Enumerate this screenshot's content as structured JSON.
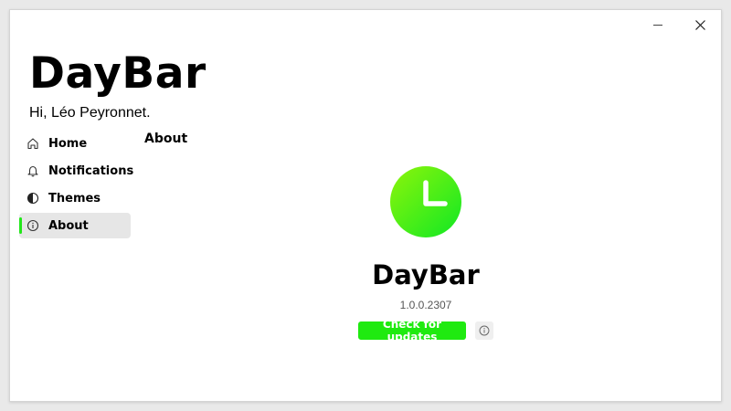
{
  "window": {
    "minimize_icon": "minimize-icon",
    "close_icon": "close-icon"
  },
  "app": {
    "title": "DayBar",
    "greeting": "Hi, Léo Peyronnet."
  },
  "nav": {
    "items": [
      {
        "label": "Home",
        "icon": "home-icon",
        "active": false
      },
      {
        "label": "Notifications",
        "icon": "bell-icon",
        "active": false
      },
      {
        "label": "Themes",
        "icon": "contrast-icon",
        "active": false
      },
      {
        "label": "About",
        "icon": "info-icon",
        "active": true
      }
    ]
  },
  "page": {
    "section_title": "About",
    "product_name": "DayBar",
    "version": "1.0.0.2307",
    "update_button_label": "Check for updates",
    "logo_icon": "clock-icon",
    "info_icon": "info-icon"
  },
  "colors": {
    "accent": "#1fea10",
    "logo_gradient_start": "#8df50a",
    "logo_gradient_end": "#10e824",
    "active_nav_bg": "#e6e6e6"
  }
}
